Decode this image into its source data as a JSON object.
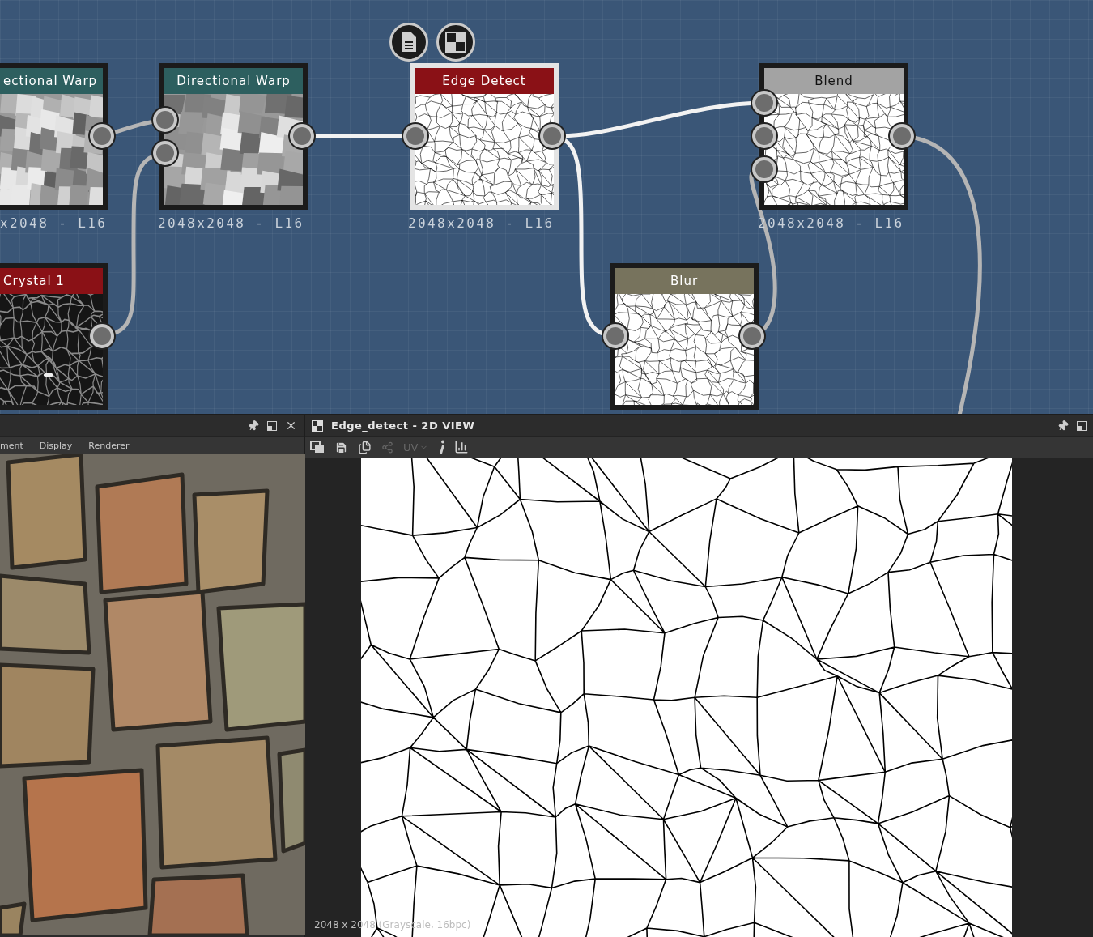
{
  "graph": {
    "nodes": [
      {
        "title": "ectional Warp",
        "color": "#2d5f5f",
        "caption": "x2048 - L16",
        "kind": "noise",
        "selected": false
      },
      {
        "title": "Directional Warp",
        "color": "#2d5f5f",
        "caption": "2048x2048 - L16",
        "kind": "noise",
        "selected": false
      },
      {
        "title": "Edge Detect",
        "color": "#8a1116",
        "caption": "2048x2048 - L16",
        "kind": "edges",
        "selected": true
      },
      {
        "title": "Blend",
        "color": "#a3a3a3",
        "caption": "2048x2048 - L16",
        "kind": "edges",
        "selected": false
      },
      {
        "title": "Crystal 1",
        "color": "#8a1116",
        "kind": "crystal",
        "selected": false
      },
      {
        "title": "Blur",
        "color": "#77735d",
        "kind": "edges",
        "selected": false
      }
    ]
  },
  "preview_3d": {
    "tabs": [
      "ment",
      "Display",
      "Renderer"
    ]
  },
  "view_2d": {
    "title": "Edge_detect - 2D VIEW",
    "toolbar": [
      {
        "kind": "view",
        "disabled": false
      },
      {
        "kind": "save",
        "disabled": false
      },
      {
        "kind": "copy",
        "disabled": false
      },
      {
        "kind": "share",
        "disabled": true
      },
      {
        "kind": "uv",
        "label": "UV",
        "disabled": true
      },
      {
        "kind": "info",
        "disabled": false
      },
      {
        "kind": "histogram",
        "disabled": false
      }
    ],
    "info": "2048 x 2048 (Grayscale, 16bpc)"
  }
}
